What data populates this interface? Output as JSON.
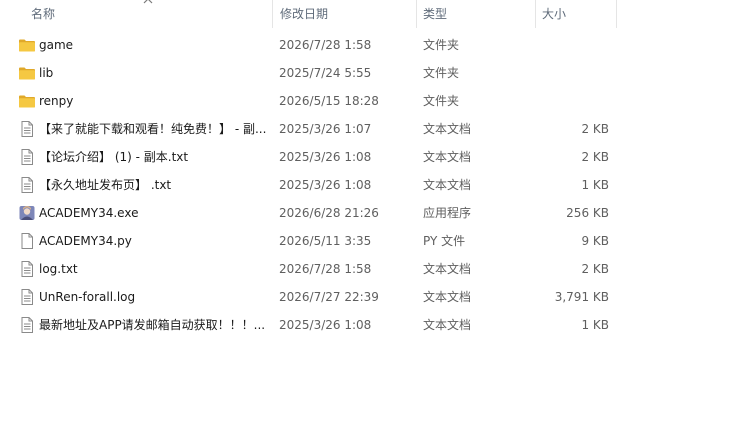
{
  "columns": {
    "name": "名称",
    "date": "修改日期",
    "type": "类型",
    "size": "大小"
  },
  "files": [
    {
      "name": "game",
      "date": "2026/7/28 1:58",
      "type": "文件夹",
      "size": "",
      "icon": "folder-icon"
    },
    {
      "name": "lib",
      "date": "2025/7/24 5:55",
      "type": "文件夹",
      "size": "",
      "icon": "folder-icon"
    },
    {
      "name": "renpy",
      "date": "2026/5/15 18:28",
      "type": "文件夹",
      "size": "",
      "icon": "folder-icon"
    },
    {
      "name": "【来了就能下载和观看！纯免费！】 - 副...",
      "date": "2025/3/26 1:07",
      "type": "文本文档",
      "size": "2 KB",
      "icon": "text-file-icon"
    },
    {
      "name": "【论坛介绍】 (1) - 副本.txt",
      "date": "2025/3/26 1:08",
      "type": "文本文档",
      "size": "2 KB",
      "icon": "text-file-icon"
    },
    {
      "name": "【永久地址发布页】 .txt",
      "date": "2025/3/26 1:08",
      "type": "文本文档",
      "size": "1 KB",
      "icon": "text-file-icon"
    },
    {
      "name": "ACADEMY34.exe",
      "date": "2026/6/28 21:26",
      "type": "应用程序",
      "size": "256 KB",
      "icon": "application-icon"
    },
    {
      "name": "ACADEMY34.py",
      "date": "2026/5/11 3:35",
      "type": "PY 文件",
      "size": "9 KB",
      "icon": "blank-file-icon"
    },
    {
      "name": "log.txt",
      "date": "2026/7/28 1:58",
      "type": "文本文档",
      "size": "2 KB",
      "icon": "text-file-icon"
    },
    {
      "name": "UnRen-forall.log",
      "date": "2026/7/27 22:39",
      "type": "文本文档",
      "size": "3,791 KB",
      "icon": "text-file-icon"
    },
    {
      "name": "最新地址及APP请发邮箱自动获取！！！...",
      "date": "2025/3/26 1:08",
      "type": "文本文档",
      "size": "1 KB",
      "icon": "text-file-icon"
    }
  ],
  "colors": {
    "folder": "#f5c842",
    "folder_dark": "#e0a92a",
    "header_text": "#5f6b7a",
    "separator": "#e5e5e5"
  }
}
